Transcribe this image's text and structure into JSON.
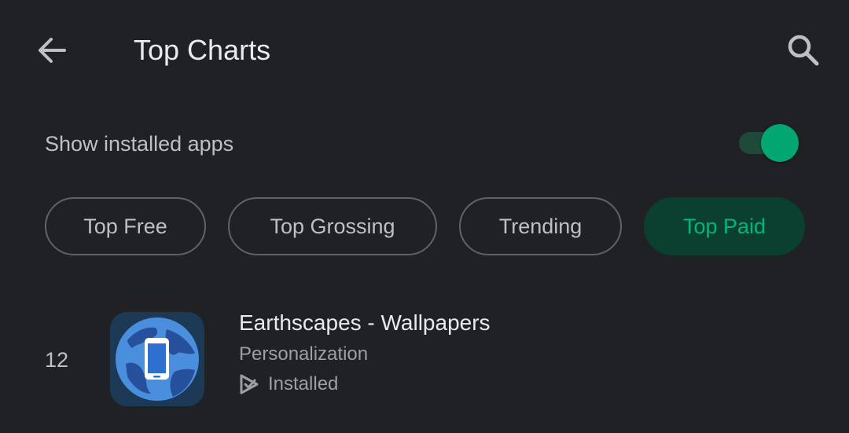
{
  "header": {
    "title": "Top Charts",
    "back_icon": "arrow-back-icon",
    "search_icon": "search-icon"
  },
  "settings": {
    "show_installed_label": "Show installed apps",
    "show_installed_on": true
  },
  "chips": [
    {
      "label": "Top Free",
      "selected": false
    },
    {
      "label": "Top Grossing",
      "selected": false
    },
    {
      "label": "Trending",
      "selected": false
    },
    {
      "label": "Top Paid",
      "selected": true
    }
  ],
  "apps": [
    {
      "rank": "12",
      "name": "Earthscapes - Wallpapers",
      "category": "Personalization",
      "status": "Installed",
      "icon": "earth-phone-icon",
      "status_icon": "installed-check-icon"
    }
  ],
  "colors": {
    "background": "#202124",
    "accent": "#01a670",
    "selected_chip_bg": "#0b3f2f",
    "selected_chip_text": "#01b67e"
  }
}
